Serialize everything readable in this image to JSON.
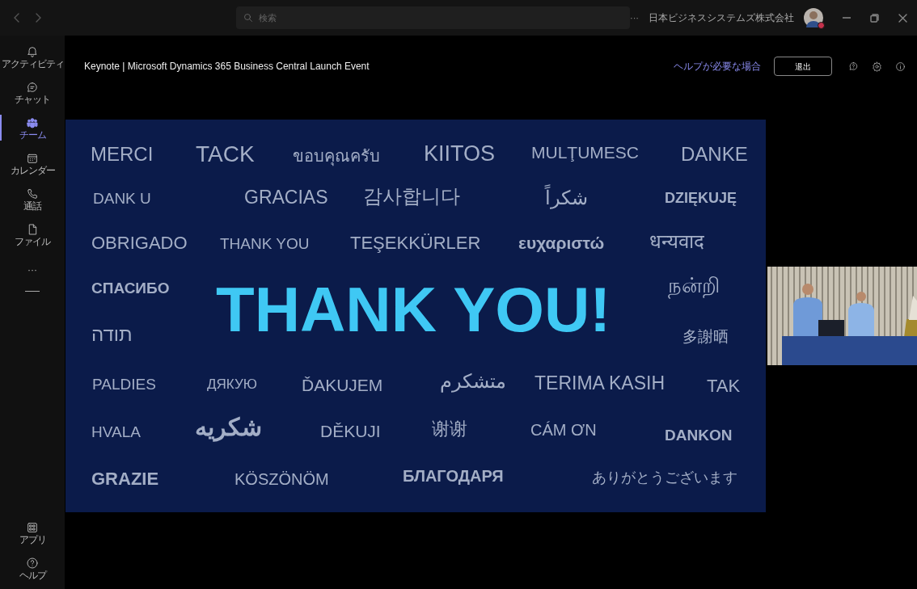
{
  "titlebar": {
    "search": {
      "placeholder": "検索"
    },
    "more": "···",
    "organization": "日本ビジネスシステムズ株式会社"
  },
  "sidebar": {
    "items": [
      {
        "kind": "bell",
        "label": "アクティビティ",
        "selected": false
      },
      {
        "kind": "chat",
        "label": "チャット",
        "selected": false
      },
      {
        "kind": "teams",
        "label": "チーム",
        "selected": true
      },
      {
        "kind": "calendar",
        "label": "カレンダー",
        "selected": false
      },
      {
        "kind": "call",
        "label": "通話",
        "selected": false
      },
      {
        "kind": "file",
        "label": "ファイル",
        "selected": false
      },
      {
        "kind": "more",
        "label": "···",
        "selected": false
      }
    ],
    "bottom_items": [
      {
        "kind": "apps",
        "label": "アプリ"
      },
      {
        "kind": "help",
        "label": "ヘルプ"
      }
    ]
  },
  "meeting": {
    "title": "Keynote | Microsoft Dynamics 365 Business Central Launch Event",
    "help_link": "ヘルプが必要な場合",
    "leave_button": "退出"
  },
  "slide": {
    "headline": "THANK YOU!",
    "words": [
      {
        "text": "MERCI",
        "bold": false
      },
      {
        "text": "TACK",
        "bold": false
      },
      {
        "text": "ขอบคุณครับ",
        "bold": false
      },
      {
        "text": "KIITOS",
        "bold": false
      },
      {
        "text": "MULŢUMESC",
        "bold": false
      },
      {
        "text": "DANKE",
        "bold": false
      },
      {
        "text": "DANK U",
        "bold": false
      },
      {
        "text": "GRACIAS",
        "bold": false
      },
      {
        "text": "감사합니다",
        "bold": false
      },
      {
        "text": "شكراً",
        "bold": false
      },
      {
        "text": "DZIĘKUJĘ",
        "bold": true
      },
      {
        "text": "OBRIGADO",
        "bold": false
      },
      {
        "text": "THANK YOU",
        "bold": false
      },
      {
        "text": "TEŞEKKÜRLER",
        "bold": false
      },
      {
        "text": "ευχαριστώ",
        "bold": true
      },
      {
        "text": "धन्यवाद",
        "bold": false
      },
      {
        "text": "СПАСИБО",
        "bold": true
      },
      {
        "text": "நன்றி",
        "bold": false
      },
      {
        "text": "תודה",
        "bold": false
      },
      {
        "text": "多謝晒",
        "bold": false
      },
      {
        "text": "PALDIES",
        "bold": false
      },
      {
        "text": "ДЯКУЮ",
        "bold": false
      },
      {
        "text": "ĎAKUJEM",
        "bold": false
      },
      {
        "text": "متشكرم",
        "bold": false
      },
      {
        "text": "TERIMA KASIH",
        "bold": false
      },
      {
        "text": "TAK",
        "bold": false
      },
      {
        "text": "HVALA",
        "bold": false
      },
      {
        "text": "شكريه",
        "bold": true
      },
      {
        "text": "DĚKUJI",
        "bold": false
      },
      {
        "text": "谢谢",
        "bold": false
      },
      {
        "text": "CÁM ƠN",
        "bold": false
      },
      {
        "text": "DANKON",
        "bold": true
      },
      {
        "text": "GRAZIE",
        "bold": true
      },
      {
        "text": "KÖSZÖNÖM",
        "bold": false
      },
      {
        "text": "БЛАГОДАРЯ",
        "bold": true
      },
      {
        "text": "ありがとうございます",
        "bold": false
      }
    ]
  }
}
